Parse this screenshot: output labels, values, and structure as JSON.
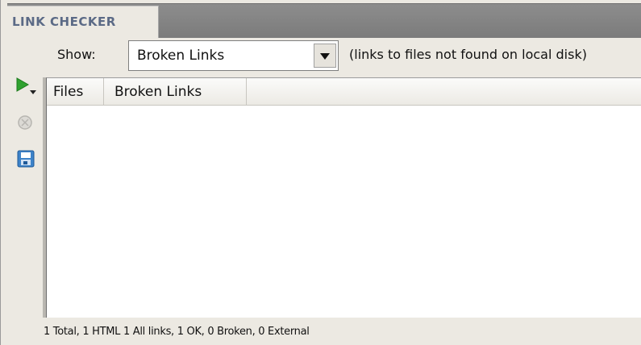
{
  "panel": {
    "tab_label": "LINK CHECKER"
  },
  "show": {
    "label": "Show:",
    "selected": "Broken Links",
    "options": [
      "Broken Links"
    ],
    "hint": "(links to files not found on local disk)"
  },
  "toolbar": {
    "icons": [
      "run-check-icon",
      "stop-icon",
      "save-report-icon"
    ]
  },
  "table": {
    "columns": [
      "Files",
      "Broken Links"
    ],
    "rows": []
  },
  "status": {
    "text": "1 Total, 1 HTML 1 All links, 1 OK, 0 Broken, 0 External"
  },
  "colors": {
    "tab_text": "#5b6a86",
    "panel_bg": "#ece9e2",
    "run_icon": "#2fa12f"
  }
}
